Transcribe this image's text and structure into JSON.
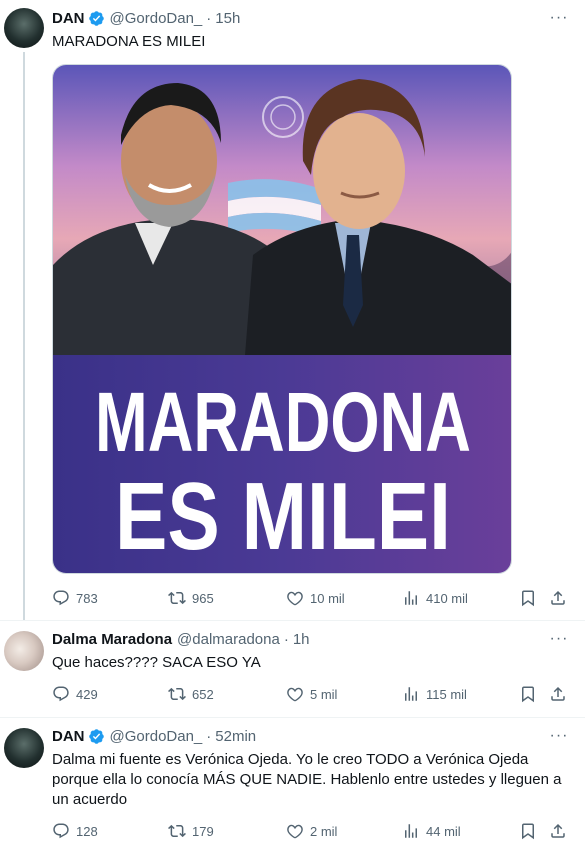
{
  "tweets": [
    {
      "name": "DAN",
      "handle": "@GordoDan_",
      "time": "15h",
      "text": "MARADONA ES MILEI",
      "image": {
        "headline_line1": "MARADONA",
        "headline_line2": "ES MILEI"
      },
      "replies": "783",
      "retweets": "965",
      "likes": "10 mil",
      "views": "410 mil"
    },
    {
      "name": "Dalma Maradona",
      "handle": "@dalmaradona",
      "time": "1h",
      "text": "Que haces???? SACA ESO YA",
      "replies": "429",
      "retweets": "652",
      "likes": "5 mil",
      "views": "115 mil"
    },
    {
      "name": "DAN",
      "handle": "@GordoDan_",
      "time": "52min",
      "text": "Dalma mi fuente es Verónica Ojeda. Yo le creo TODO a Verónica Ojeda porque ella lo conocía MÁS QUE NADIE. Hablenlo entre ustedes y lleguen a un acuerdo",
      "replies": "128",
      "retweets": "179",
      "likes": "2 mil",
      "views": "44 mil"
    }
  ],
  "colors": {
    "verified": "#1d9bf0",
    "secondary_text": "#536471",
    "image_purple": "#4a3a8a"
  },
  "icons": [
    "verified-badge-icon",
    "more-icon",
    "reply-icon",
    "retweet-icon",
    "like-icon",
    "views-icon",
    "bookmark-icon",
    "share-icon"
  ]
}
